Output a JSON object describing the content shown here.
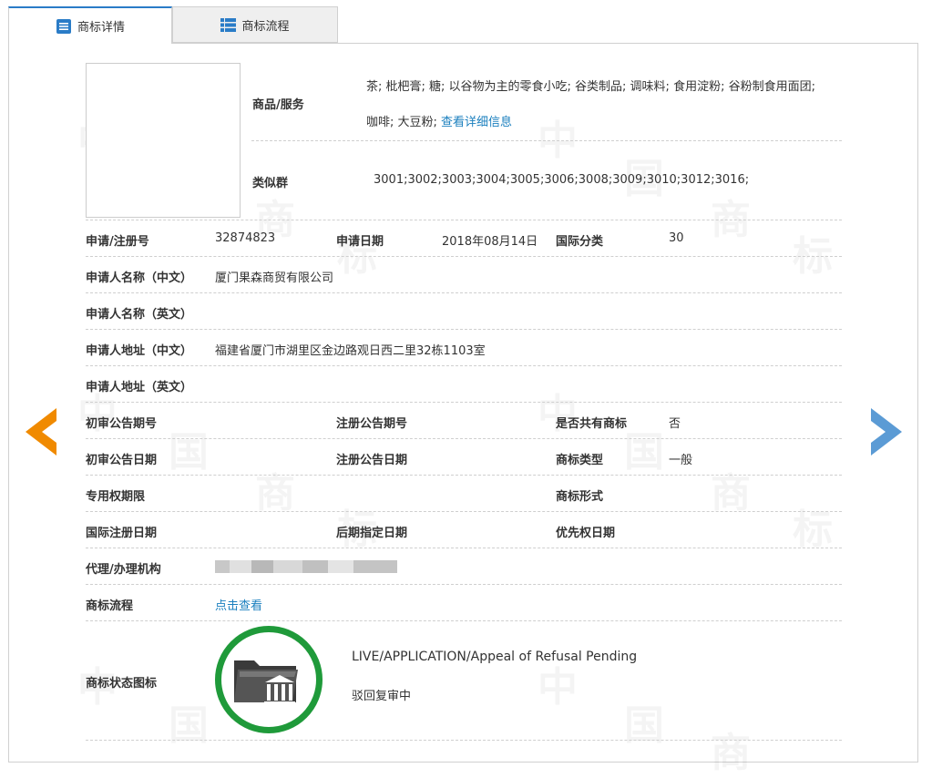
{
  "tabs": [
    {
      "label": "商标详情",
      "icon": "list-doc-icon",
      "active": true
    },
    {
      "label": "商标流程",
      "icon": "table-list-icon",
      "active": false
    }
  ],
  "goods": {
    "label": "商品/服务",
    "text_line1": "茶; 枇杷膏; 糖; 以谷物为主的零食小吃; 谷类制品; 调味料; 食用淀粉; 谷粉制食用面团;",
    "text_line2": "咖啡; 大豆粉;",
    "detail_link": "查看详细信息"
  },
  "similar_group": {
    "label": "类似群",
    "value": "3001;3002;3003;3004;3005;3006;3008;3009;3010;3012;3016;"
  },
  "reg_no": {
    "label": "申请/注册号",
    "value": "32874823"
  },
  "apply_date": {
    "label": "申请日期",
    "value": "2018年08月14日"
  },
  "intl_class": {
    "label": "国际分类",
    "value": "30"
  },
  "applicant_cn": {
    "label": "申请人名称（中文）",
    "value": "厦门果森商贸有限公司"
  },
  "applicant_en": {
    "label": "申请人名称（英文）",
    "value": ""
  },
  "address_cn": {
    "label": "申请人地址（中文）",
    "value": "福建省厦门市湖里区金边路观日西二里32栋1103室"
  },
  "address_en": {
    "label": "申请人地址（英文）",
    "value": ""
  },
  "prelim_pub_no": {
    "label": "初审公告期号",
    "value": ""
  },
  "reg_pub_no": {
    "label": "注册公告期号",
    "value": ""
  },
  "shared": {
    "label": "是否共有商标",
    "value": "否"
  },
  "prelim_pub_date": {
    "label": "初审公告日期",
    "value": ""
  },
  "reg_pub_date": {
    "label": "注册公告日期",
    "value": ""
  },
  "tm_type": {
    "label": "商标类型",
    "value": "一般"
  },
  "exclusive_period": {
    "label": "专用权期限",
    "value": ""
  },
  "tm_form": {
    "label": "商标形式",
    "value": ""
  },
  "intl_reg_date": {
    "label": "国际注册日期",
    "value": ""
  },
  "later_designation": {
    "label": "后期指定日期",
    "value": ""
  },
  "priority_date": {
    "label": "优先权日期",
    "value": ""
  },
  "agent": {
    "label": "代理/办理机构",
    "value": "[blurred]"
  },
  "process": {
    "label": "商标流程",
    "link": "点击查看"
  },
  "status": {
    "label": "商标状态图标",
    "icon": "folder-court-icon",
    "line_en": "LIVE/APPLICATION/Appeal of Refusal Pending",
    "line_cn": "驳回复审中",
    "ring_color": "#1f9a3a"
  },
  "nav": {
    "prev_icon": "left-arrow-icon",
    "next_icon": "right-arrow-icon",
    "prev_color": "#f08a00",
    "next_color": "#5b9bd5"
  },
  "watermark": [
    "中",
    "国",
    "商",
    "标"
  ]
}
